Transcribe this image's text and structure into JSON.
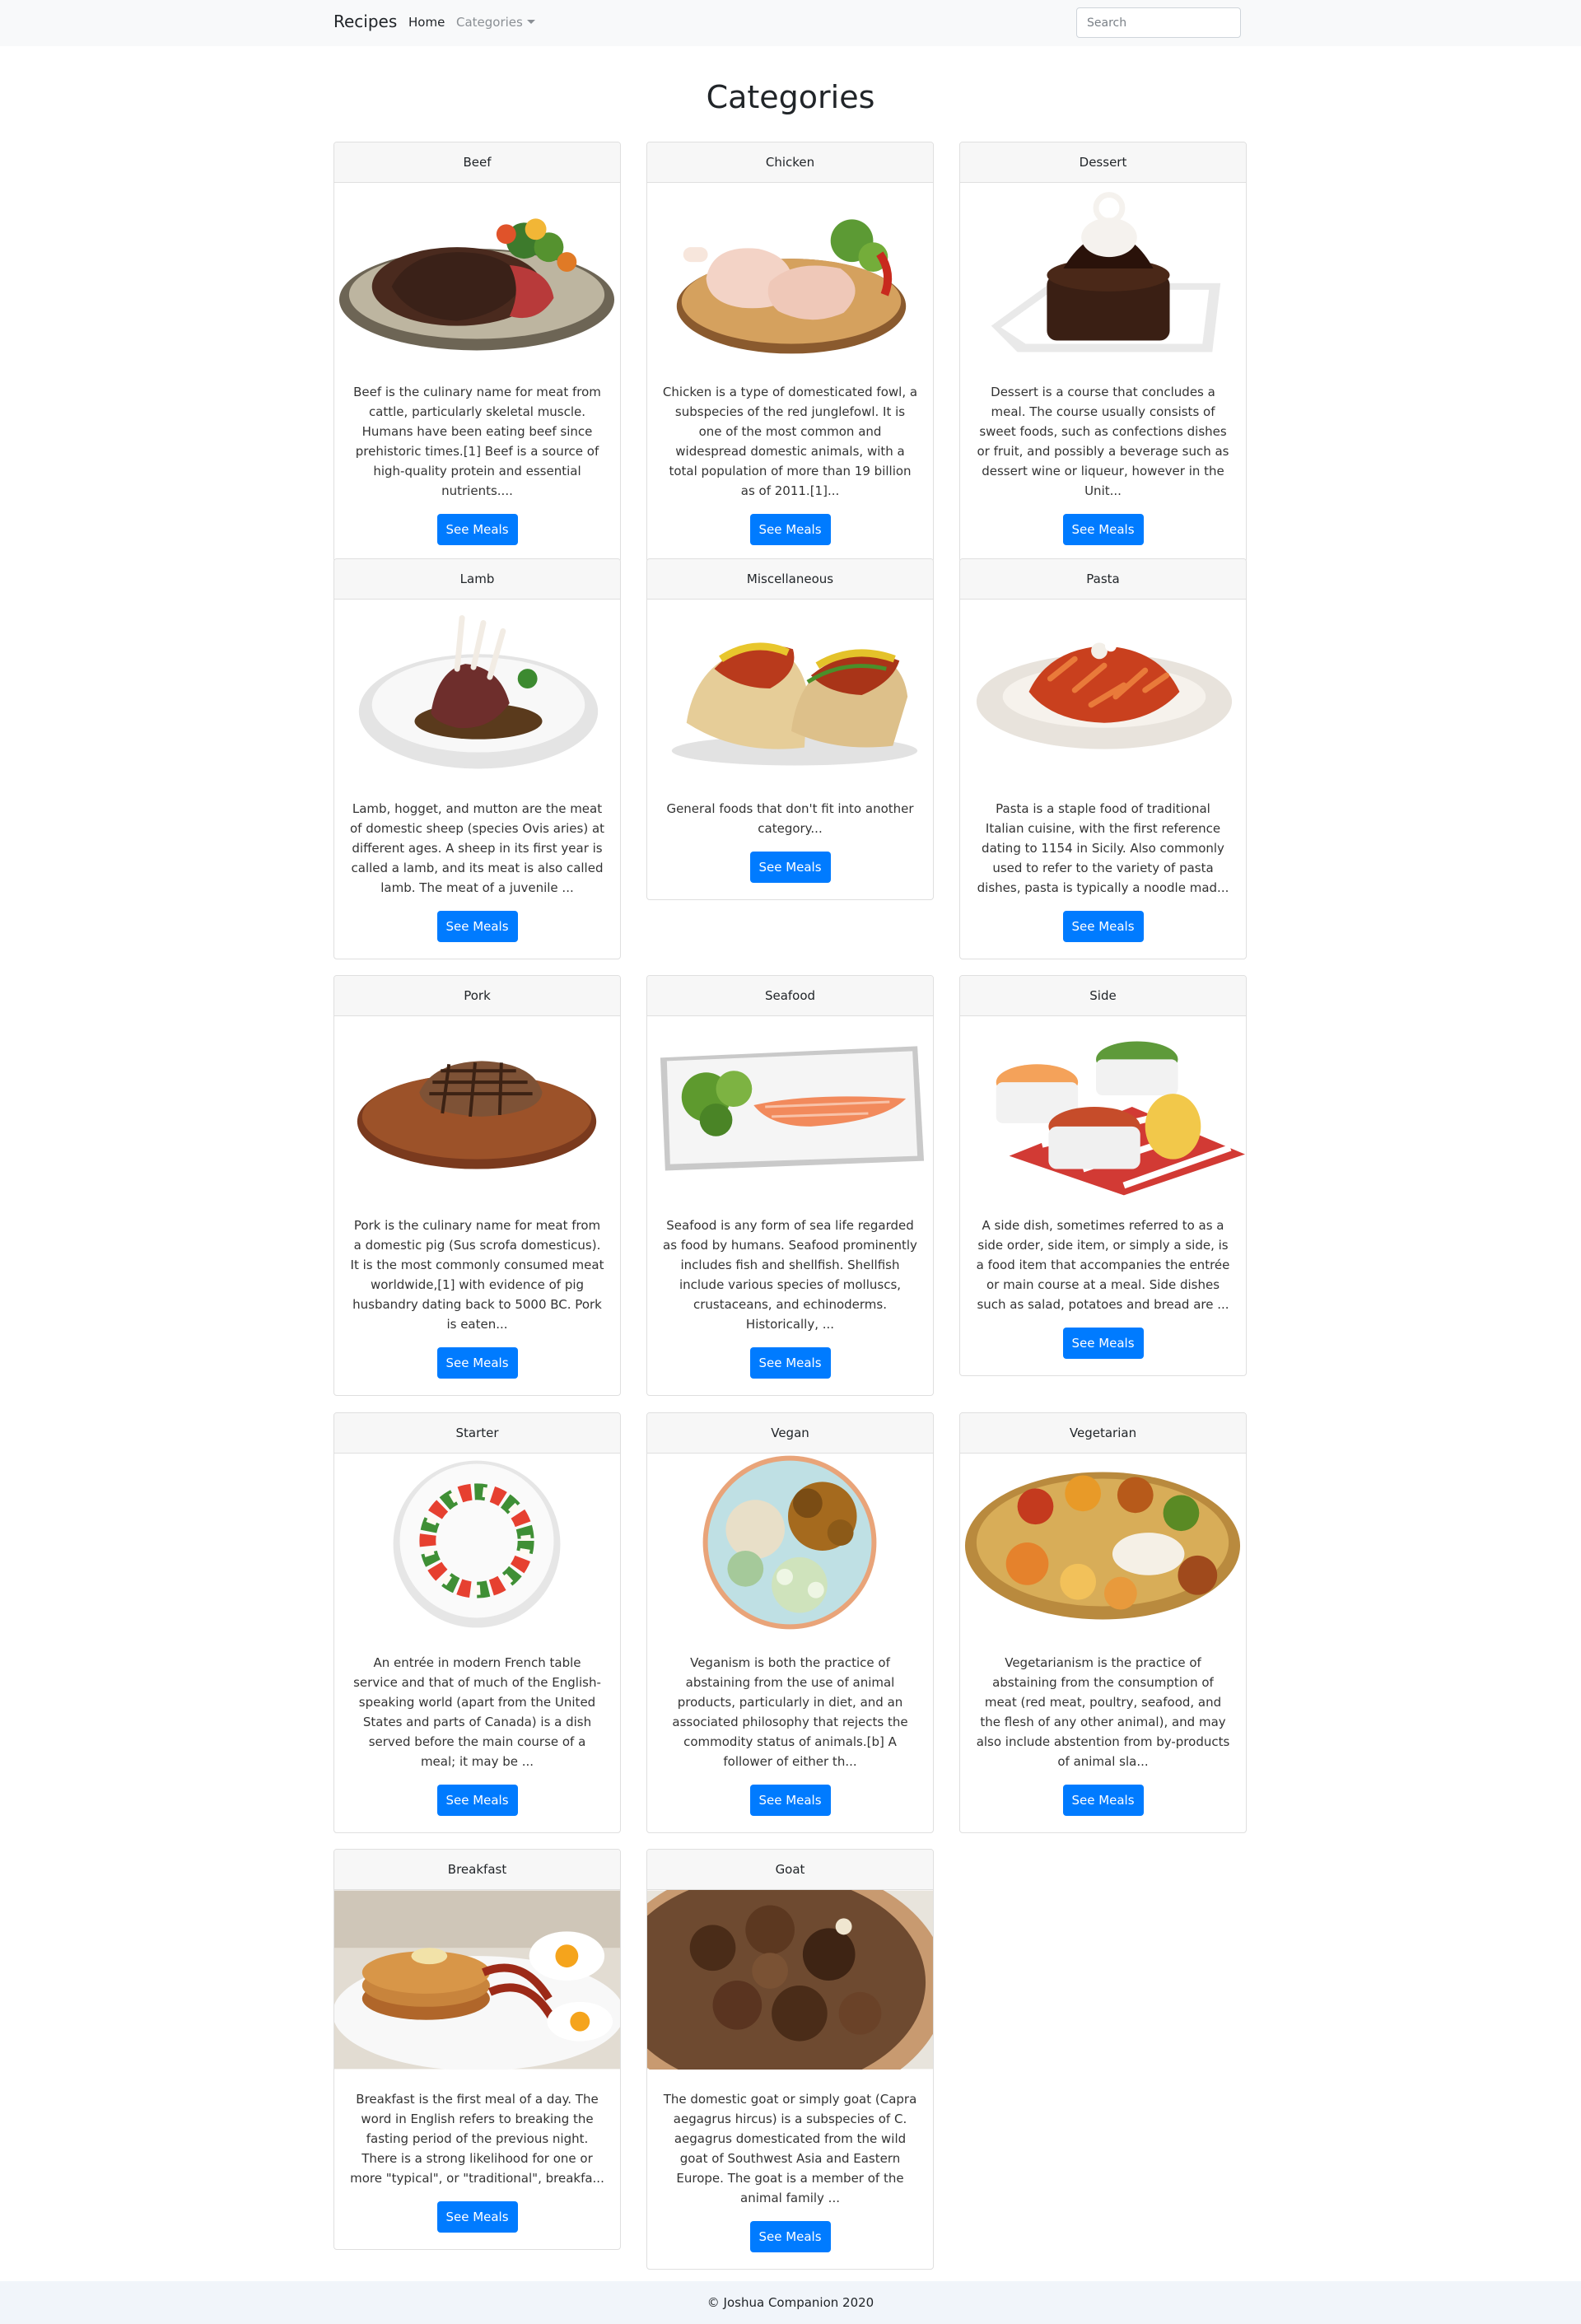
{
  "nav": {
    "brand": "Recipes",
    "home": "Home",
    "categories": "Categories",
    "search_placeholder": "Search"
  },
  "page": {
    "title": "Categories"
  },
  "button_label": "See Meals",
  "cards": [
    {
      "name": "Beef",
      "text": "Beef is the culinary name for meat from cattle, particularly skeletal muscle. Humans have been eating beef since prehistoric times.[1] Beef is a source of high-quality protein and essential nutrients...."
    },
    {
      "name": "Chicken",
      "text": "Chicken is a type of domesticated fowl, a subspecies of the red junglefowl. It is one of the most common and widespread domestic animals, with a total population of more than 19 billion as of 2011.[1]..."
    },
    {
      "name": "Dessert",
      "text": "Dessert is a course that concludes a meal. The course usually consists of sweet foods, such as confections dishes or fruit, and possibly a beverage such as dessert wine or liqueur, however in the Unit..."
    },
    {
      "name": "Lamb",
      "text": "Lamb, hogget, and mutton are the meat of domestic sheep (species Ovis aries) at different ages. A sheep in its first year is called a lamb, and its meat is also called lamb. The meat of a juvenile ..."
    },
    {
      "name": "Miscellaneous",
      "text": "General foods that don't fit into another category..."
    },
    {
      "name": "Pasta",
      "text": "Pasta is a staple food of traditional Italian cuisine, with the first reference dating to 1154 in Sicily. Also commonly used to refer to the variety of pasta dishes, pasta is typically a noodle mad..."
    },
    {
      "name": "Pork",
      "text": "Pork is the culinary name for meat from a domestic pig (Sus scrofa domesticus). It is the most commonly consumed meat worldwide,[1] with evidence of pig husbandry dating back to 5000 BC. Pork is eaten..."
    },
    {
      "name": "Seafood",
      "text": "Seafood is any form of sea life regarded as food by humans. Seafood prominently includes fish and shellfish. Shellfish include various species of molluscs, crustaceans, and echinoderms. Historically, ..."
    },
    {
      "name": "Side",
      "text": "A side dish, sometimes referred to as a side order, side item, or simply a side, is a food item that accompanies the entrée or main course at a meal. Side dishes such as salad, potatoes and bread are ..."
    },
    {
      "name": "Starter",
      "text": "An entrée in modern French table service and that of much of the English-speaking world (apart from the United States and parts of Canada) is a dish served before the main course of a meal; it may be ..."
    },
    {
      "name": "Vegan",
      "text": "Veganism is both the practice of abstaining from the use of animal products, particularly in diet, and an associated philosophy that rejects the commodity status of animals.[b] A follower of either th..."
    },
    {
      "name": "Vegetarian",
      "text": "Vegetarianism is the practice of abstaining from the consumption of meat (red meat, poultry, seafood, and the flesh of any other animal), and may also include abstention from by-products of animal sla..."
    },
    {
      "name": "Breakfast",
      "text": "Breakfast is the first meal of a day. The word in English refers to breaking the fasting period of the previous night. There is a strong likelihood for one or more \"typical\", or \"traditional\", breakfa..."
    },
    {
      "name": "Goat",
      "text": "The domestic goat or simply goat (Capra aegagrus hircus) is a subspecies of C. aegagrus domesticated from the wild goat of Southwest Asia and Eastern Europe. The goat is a member of the animal family ..."
    }
  ],
  "footer": {
    "text": "© Joshua Companion 2020"
  },
  "colors": {
    "primary": "#007bff",
    "navbar_bg": "#f8f9fa",
    "footer_bg": "#f1f5fa"
  }
}
